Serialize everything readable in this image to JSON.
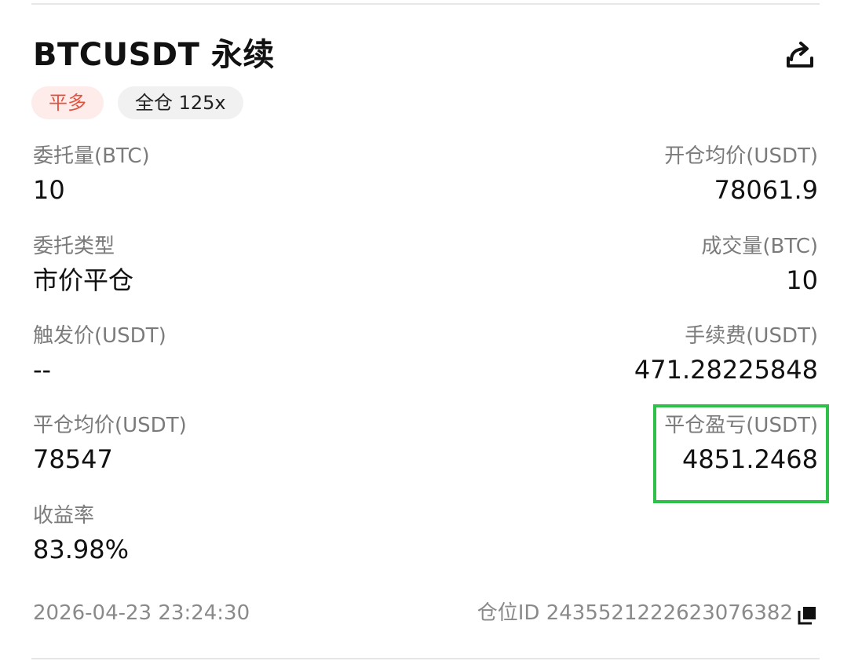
{
  "header": {
    "title": "BTCUSDT 永续",
    "share_icon": "share-icon"
  },
  "tags": {
    "side": "平多",
    "margin": "全仓 125x"
  },
  "fields": {
    "order_qty": {
      "label": "委托量(BTC)",
      "value": "10"
    },
    "open_avg_price": {
      "label": "开仓均价(USDT)",
      "value": "78061.9"
    },
    "order_type": {
      "label": "委托类型",
      "value": "市价平仓"
    },
    "filled_qty": {
      "label": "成交量(BTC)",
      "value": "10"
    },
    "trigger_price": {
      "label": "触发价(USDT)",
      "value": "--"
    },
    "fee": {
      "label": "手续费(USDT)",
      "value": "471.28225848"
    },
    "close_avg_price": {
      "label": "平仓均价(USDT)",
      "value": "78547"
    },
    "close_pnl": {
      "label": "平仓盈亏(USDT)",
      "value": "4851.2468"
    },
    "roi": {
      "label": "收益率",
      "value": "83.98%"
    }
  },
  "footer": {
    "time": "2026-04-23 23:24:30",
    "position_id": "仓位ID 2435521222623076382",
    "copy_icon": "copy-icon"
  },
  "colors": {
    "side_tag_text": "#e2533f",
    "side_tag_bg": "#fdecea",
    "highlight_border": "#2fc04a",
    "label": "#7b7b7b"
  }
}
